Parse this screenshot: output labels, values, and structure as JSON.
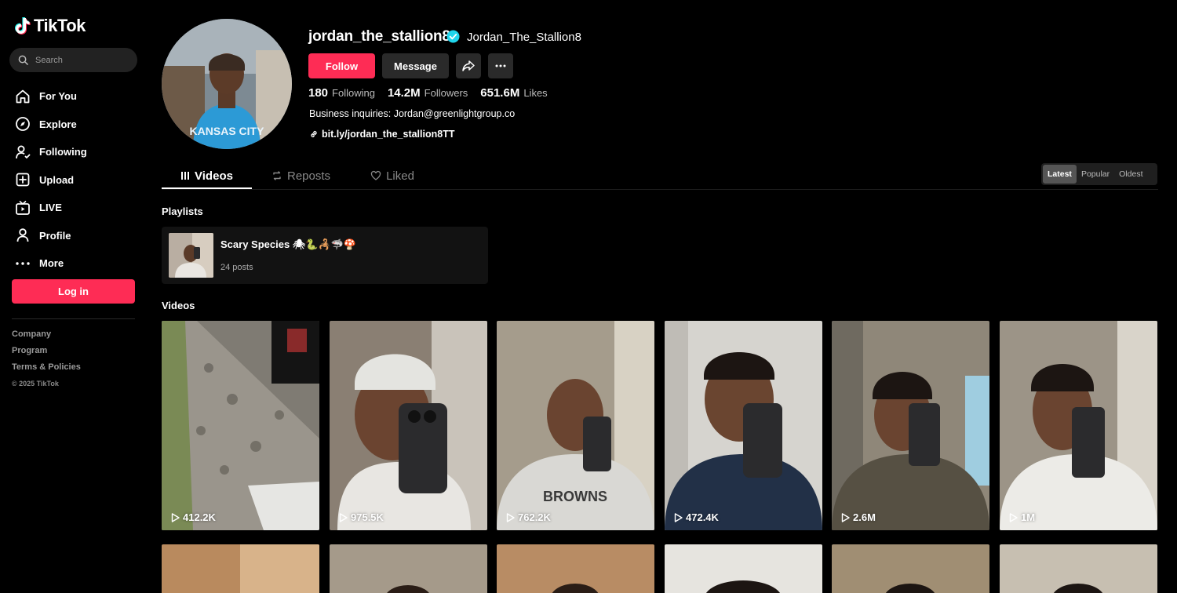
{
  "brand": {
    "name": "TikTok"
  },
  "search": {
    "placeholder": "Search"
  },
  "nav": [
    {
      "label": "For You",
      "icon": "home-icon"
    },
    {
      "label": "Explore",
      "icon": "compass-icon"
    },
    {
      "label": "Following",
      "icon": "following-icon"
    },
    {
      "label": "Upload",
      "icon": "upload-icon"
    },
    {
      "label": "LIVE",
      "icon": "live-icon"
    },
    {
      "label": "Profile",
      "icon": "profile-icon"
    },
    {
      "label": "More",
      "icon": "more-icon"
    }
  ],
  "login_label": "Log in",
  "footer": {
    "links": [
      "Company",
      "Program",
      "Terms & Policies"
    ],
    "copyright": "© 2025 TikTok"
  },
  "profile": {
    "username": "jordan_the_stallion8",
    "nickname": "Jordan_The_Stallion8",
    "follow_label": "Follow",
    "message_label": "Message",
    "stats": {
      "following": {
        "value": "180",
        "label": "Following"
      },
      "followers": {
        "value": "14.2M",
        "label": "Followers"
      },
      "likes": {
        "value": "651.6M",
        "label": "Likes"
      }
    },
    "bio": "Business inquiries: Jordan@greenlightgroup.co",
    "link": "bit.ly/jordan_the_stallion8TT"
  },
  "tabs": [
    {
      "label": "Videos",
      "active": true
    },
    {
      "label": "Reposts",
      "active": false
    },
    {
      "label": "Liked",
      "active": false
    }
  ],
  "sort": {
    "options": [
      "Latest",
      "Popular",
      "Oldest"
    ],
    "selected": "Latest"
  },
  "playlists": {
    "title": "Playlists",
    "items": [
      {
        "title": "Scary Species 🕷🐍🦂🦈🍄",
        "count": "24 posts"
      }
    ]
  },
  "videos": {
    "title": "Videos",
    "items": [
      {
        "views": "412.2K"
      },
      {
        "views": "975.5K"
      },
      {
        "views": "762.2K"
      },
      {
        "views": "472.4K"
      },
      {
        "views": "2.6M"
      },
      {
        "views": "1M"
      }
    ]
  },
  "colors": {
    "accent": "#fe2c55",
    "verified": "#20d5ec",
    "background": "#000000"
  }
}
